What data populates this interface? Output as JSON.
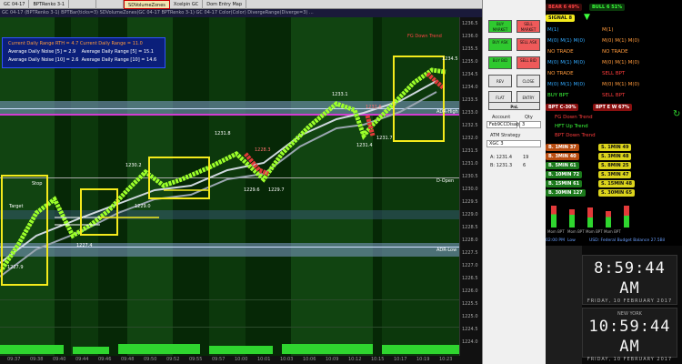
{
  "topbar": {
    "tabs": [
      "GC 04-17",
      "BPTRenko 3-1",
      "",
      "",
      "SDVolumeZones",
      "Xcelpin GC",
      "Dom Entry Map"
    ]
  },
  "titlebar": {
    "text": "GC 04-17 (BPTRenko 3-1) BPTBar(ticks=3) SDVolumeZones(GC 04-17 BPTRenko 3-1) GC 04-17 Color(Color) DivergeRange(Diverge=3) ..."
  },
  "infobox": {
    "line1": "Current Daily Range RTH = 4.7     Current Daily Range = 11.0",
    "line2_a": "Average Daily Noise [5] = 2.9",
    "line2_b": "Average Daily Range [5] = 15.1",
    "line3_a": "Average Daily Noise [10] = 2.6",
    "line3_b": "Average Daily Range [10] = 14.6"
  },
  "chart": {
    "down_trend_label": "FG Down Trend",
    "adr_high": "ADR-High",
    "adr_low": "ADR-Low",
    "d_open": "D-Open",
    "swing_high": "1233.1",
    "swing_low": "1227.4",
    "mid_label": "1231.8",
    "label_1230_2": "1230.2",
    "label_1229_6": "1229.6",
    "label_1229_7": "1229.7",
    "label_1229_0": "1229.0",
    "label_1231_4": "1231.4",
    "label_1231_7": "1231.7",
    "label_1227_9": "1227.9",
    "label_1228_3": "1228.3",
    "label_1232_6": "1232.6",
    "label_1234_5": "1234.5",
    "target_label": "Target",
    "stop_label": "Stop"
  },
  "yaxis": [
    "1236.5",
    "1236.0",
    "1235.5",
    "1235.0",
    "1234.5",
    "1234.0",
    "1233.5",
    "1233.0",
    "1232.5",
    "1232.0",
    "1231.5",
    "1231.0",
    "1230.5",
    "1230.0",
    "1229.5",
    "1229.0",
    "1228.5",
    "1228.0",
    "1227.5",
    "1227.0",
    "1226.5",
    "1226.0",
    "1225.5",
    "1225.0",
    "1224.5",
    "1224.0"
  ],
  "xaxis": [
    "09:37",
    "09:38",
    "09:40",
    "09:44",
    "09:46",
    "09:48",
    "09:50",
    "09:52",
    "09:55",
    "09:57",
    "10:00",
    "10:01",
    "10:03",
    "10:06",
    "10:09",
    "10:12",
    "10:15",
    "10:17",
    "10:19",
    "10:23"
  ],
  "panel": {
    "buy_market": "BUY MARKET",
    "sell_market": "SELL MARKET",
    "buy_ask": "BUY ASK",
    "sell_ask": "SELL ASK",
    "buy_bid": "BUY BID",
    "sell_bid": "SELL BID",
    "rev": "REV",
    "close": "CLOSE",
    "flat": "FLAT",
    "entry": "ENTRY",
    "pnl": "PnL",
    "account_label": "Account",
    "qty_label": "Qty",
    "account_value": "Feb9CCDisabo",
    "qty_value": "3",
    "atm_label": "ATM Strategy",
    "atm_value": "XGC 3",
    "bid_row": "A: 1231.4",
    "bid_qty": "19",
    "ask_row": "B: 1231.3",
    "ask_qty": "6"
  },
  "signals": {
    "bear": "BEAR 6 49%",
    "bull": "BULL 6 51%",
    "signal": "SIGNAL 8",
    "m_rows": [
      [
        "M(1)",
        "M(1)"
      ],
      [
        "M(0) M(1) M(0)",
        "M(0) M(1) M(0)"
      ],
      [
        "NO TRADE",
        "NO TRADE"
      ],
      [
        "M(0) M(1) M(0)",
        "M(0) M(1) M(0)"
      ],
      [
        "NO TRADE",
        "SELL BPT"
      ],
      [
        "M(0) M(1) M(0)",
        "M(0) M(1) M(0)"
      ],
      [
        "BUY BPT",
        "SELL BPT"
      ]
    ],
    "bpt_c": "BPT C-30%",
    "bpt_e": "BPT E W 67%",
    "fg_down": "FG Down Trend",
    "hft_up": "HFT Up Trend",
    "bpt_down": "BPT Down Trend",
    "min_rows": [
      [
        "B. 1MIN 37",
        "S. 1MIN 49"
      ],
      [
        "B. 3MIN 40",
        "S. 3MIN 48"
      ],
      [
        "B. 5MIN 61",
        "S. 8MIN 25"
      ],
      [
        "B. 10MIN 72",
        "S. 3MIN 47"
      ],
      [
        "B. 15MIN 61",
        "S. 15MIN 48"
      ],
      [
        "B. 30MIN 127",
        "S. 30MIN 65"
      ]
    ],
    "bottom_labels": [
      "Mom BPT",
      "Mom BPT",
      "Mom BPT",
      "Mom BPT"
    ],
    "time_row": "02:00 PM",
    "low_label": "Low",
    "usd_label": "USD: Federal Budget Balance 27.5Bil"
  },
  "clock1": {
    "city": "",
    "time": "8:59:44 AM",
    "date": "FRIDAY, 10 FEBRUARY 2017"
  },
  "clock2": {
    "city": "NEW YORK",
    "time": "10:59:44 AM",
    "date": "FRIDAY, 10 FEBRUARY 2017"
  },
  "colors": {
    "bull_green": "#9cff2a",
    "bear_red": "#e23a3a",
    "highlight": "#f4ea1c",
    "band_blue": "#6f8fb5"
  }
}
